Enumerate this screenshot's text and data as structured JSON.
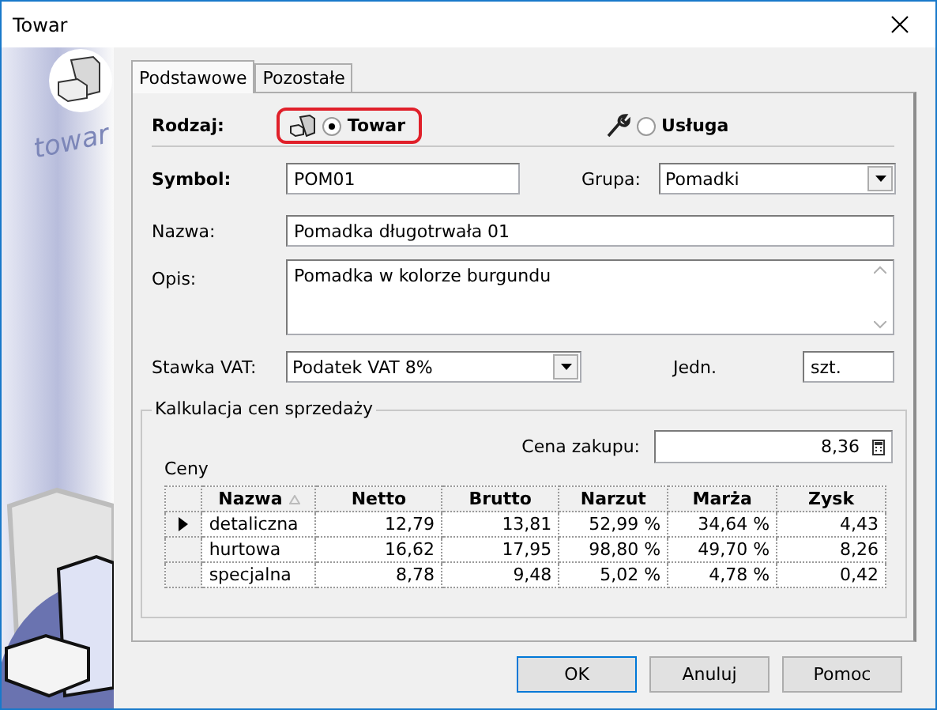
{
  "window": {
    "title": "Towar"
  },
  "banner": {
    "word": "towar"
  },
  "tabs": [
    {
      "label": "Podstawowe",
      "selected": true
    },
    {
      "label": "Pozostałe",
      "selected": false
    }
  ],
  "rodzaj": {
    "label": "Rodzaj:",
    "options": [
      {
        "label": "Towar",
        "kind": "product",
        "selected": true
      },
      {
        "label": "Usługa",
        "kind": "service",
        "selected": false
      }
    ]
  },
  "symbol": {
    "label": "Symbol:",
    "value": "POM01"
  },
  "grupa": {
    "label": "Grupa:",
    "value": "Pomadki"
  },
  "nazwa": {
    "label": "Nazwa:",
    "value": "Pomadka długotrwała 01"
  },
  "opis": {
    "label": "Opis:",
    "value": "Pomadka w kolorze burgundu"
  },
  "stawka_vat": {
    "label": "Stawka VAT:",
    "value": "Podatek VAT 8%"
  },
  "jednostka": {
    "label": "Jedn.",
    "value": "szt."
  },
  "kalkulacja": {
    "title": "Kalkulacja cen sprzedaży",
    "cena_zakupu_label": "Cena zakupu:",
    "cena_zakupu": "8,36",
    "ceny_label": "Ceny",
    "columns": [
      {
        "label": "Nazwa",
        "sorted": true
      },
      {
        "label": "Netto",
        "sorted": false
      },
      {
        "label": "Brutto",
        "sorted": false
      },
      {
        "label": "Narzut",
        "sorted": false
      },
      {
        "label": "Marża",
        "sorted": false
      },
      {
        "label": "Zysk",
        "sorted": false
      }
    ],
    "rows": [
      {
        "selected": true,
        "cells": [
          "detaliczna",
          "12,79",
          "13,81",
          "52,99 %",
          "34,64 %",
          "4,43"
        ]
      },
      {
        "selected": false,
        "cells": [
          "hurtowa",
          "16,62",
          "17,95",
          "98,80 %",
          "49,70 %",
          "8,26"
        ]
      },
      {
        "selected": false,
        "cells": [
          "specjalna",
          "8,78",
          "9,48",
          "5,02 %",
          "4,78 %",
          "0,42"
        ]
      }
    ]
  },
  "buttons": [
    "OK",
    "Anuluj",
    "Pomoc"
  ]
}
